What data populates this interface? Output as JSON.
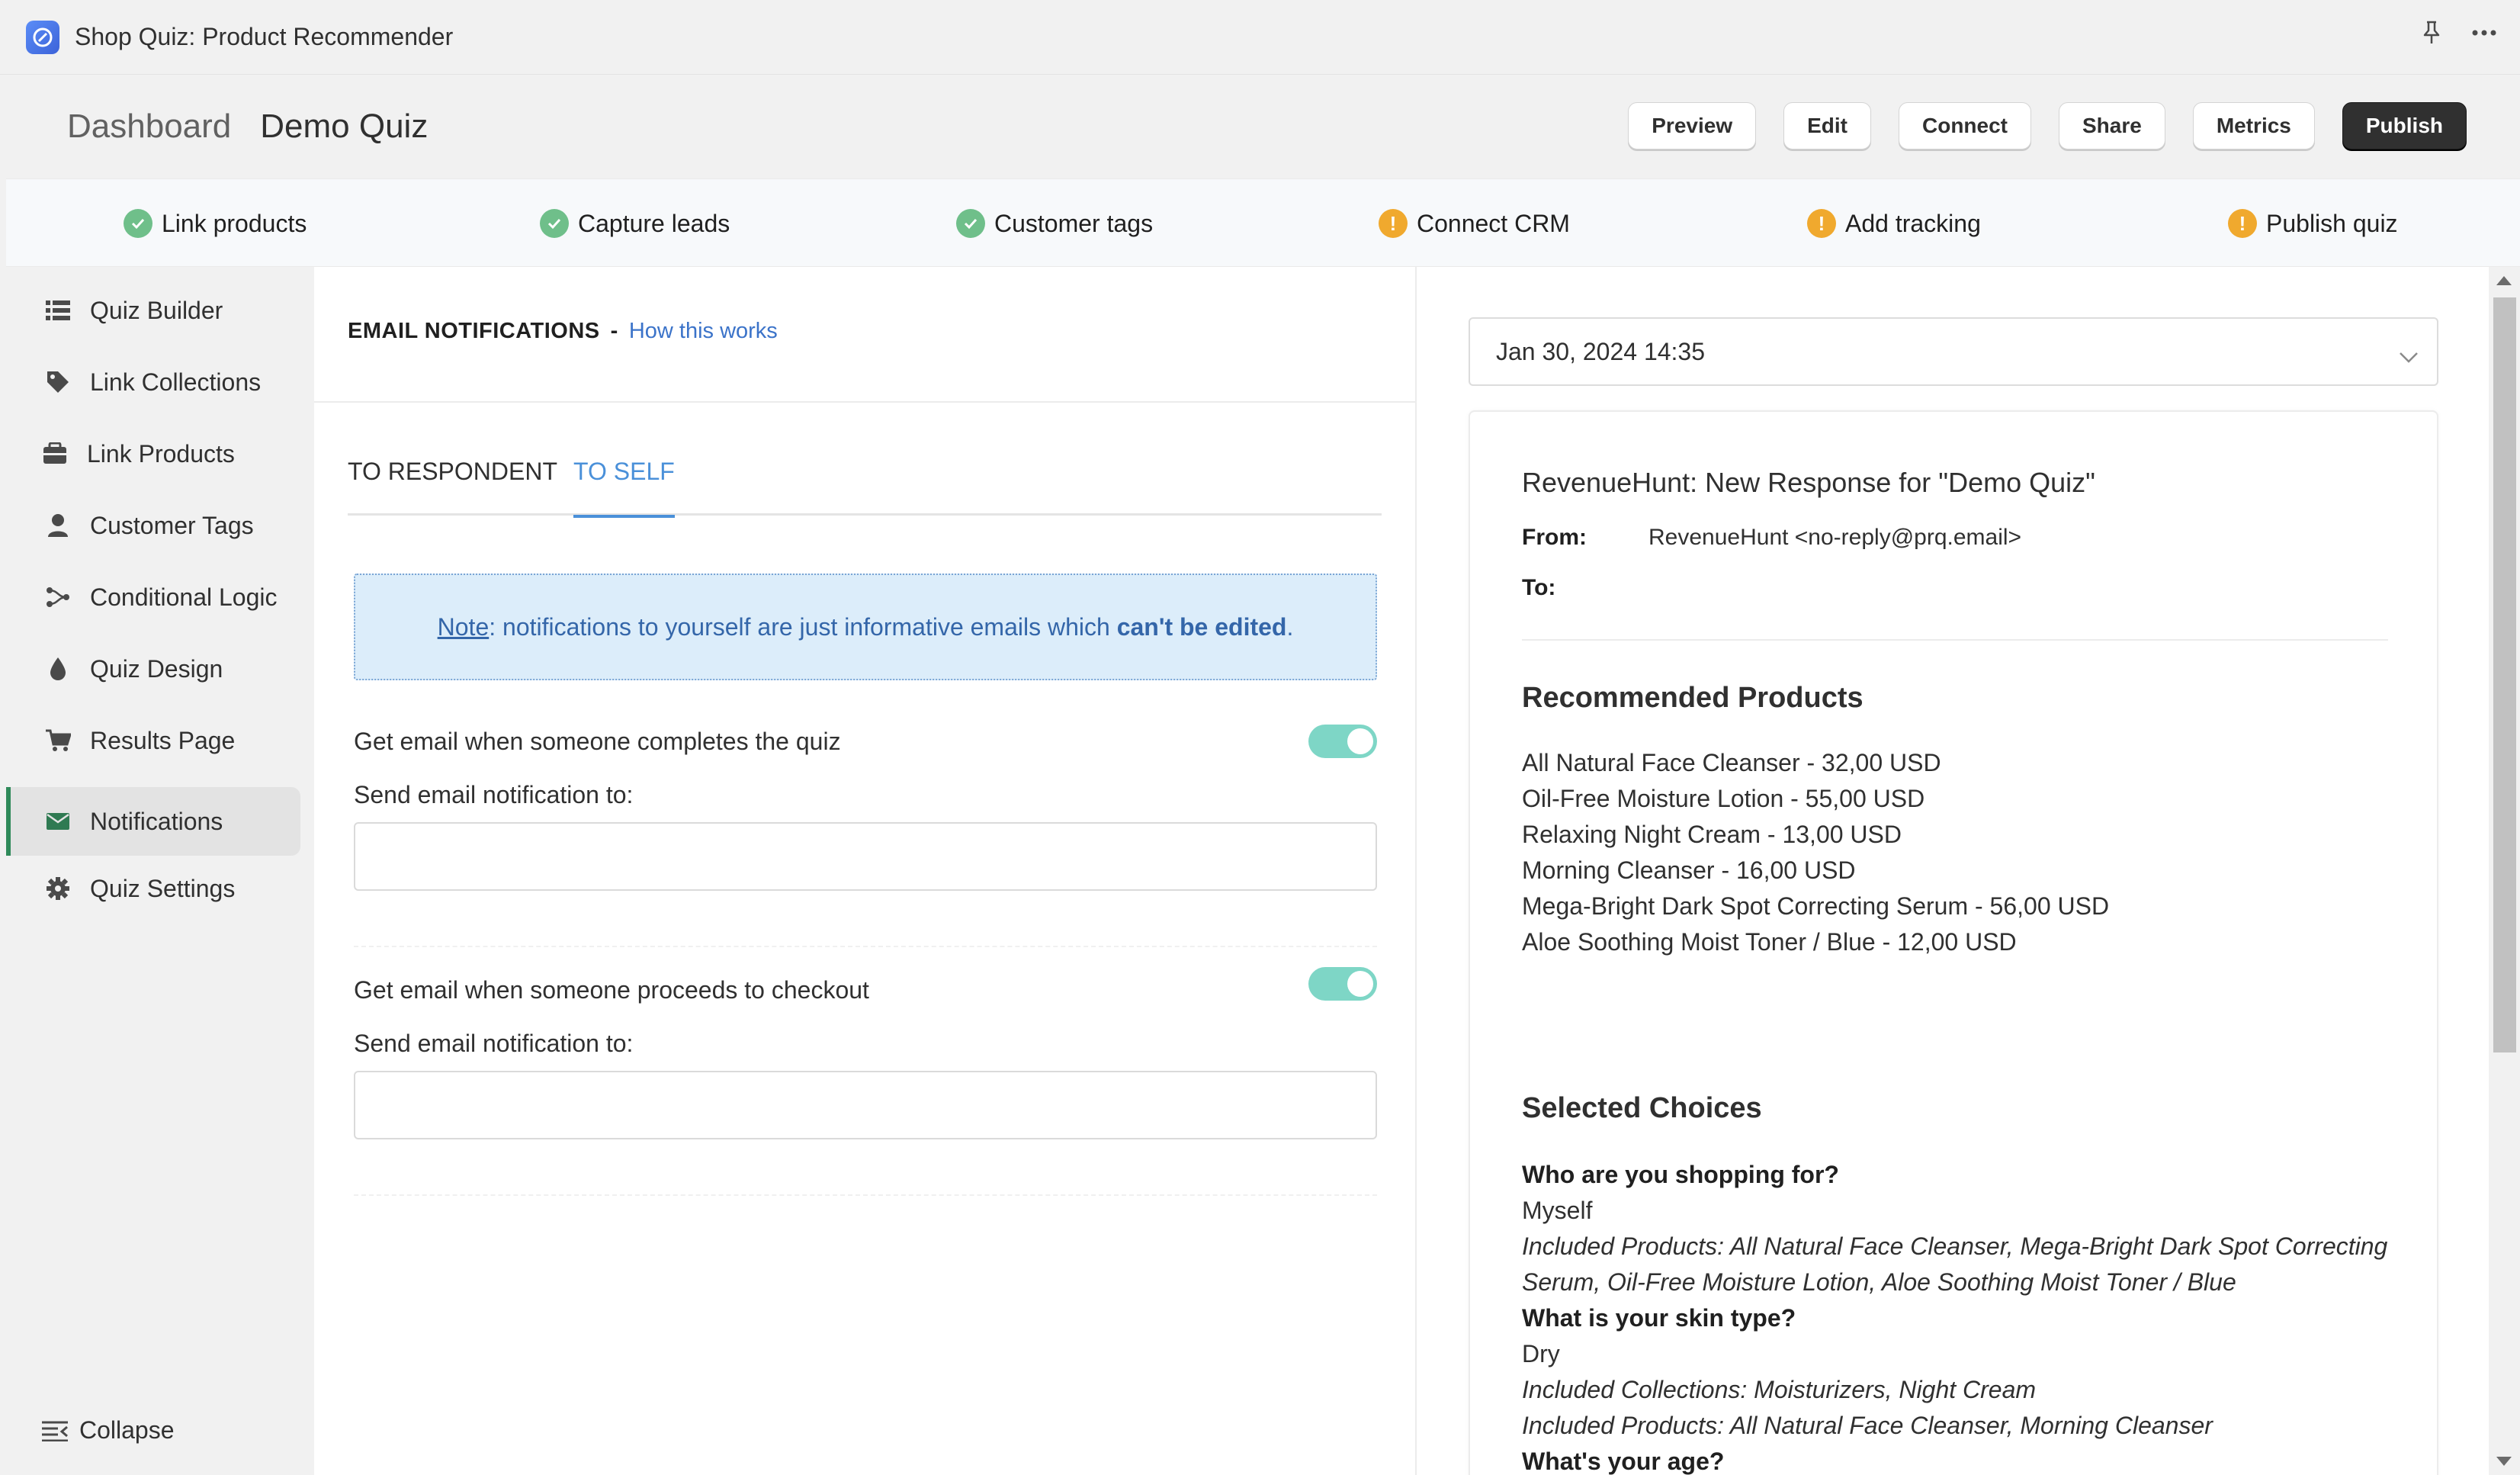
{
  "window": {
    "title": "Shop Quiz: Product Recommender",
    "icons": [
      "app-logo-icon",
      "pin-icon",
      "more-icon"
    ]
  },
  "header": {
    "breadcrumb": "Dashboard",
    "title": "Demo Quiz",
    "actions": {
      "preview": "Preview",
      "edit": "Edit",
      "connect": "Connect",
      "share": "Share",
      "metrics": "Metrics",
      "publish": "Publish"
    }
  },
  "progress_steps": [
    {
      "label": "Link products",
      "status": "done"
    },
    {
      "label": "Capture leads",
      "status": "done"
    },
    {
      "label": "Customer tags",
      "status": "done"
    },
    {
      "label": "Connect CRM",
      "status": "warning"
    },
    {
      "label": "Add tracking",
      "status": "warning"
    },
    {
      "label": "Publish quiz",
      "status": "warning"
    }
  ],
  "sidebar": {
    "items": [
      {
        "label": "Quiz Builder",
        "icon": "list-icon"
      },
      {
        "label": "Link Collections",
        "icon": "tag-icon"
      },
      {
        "label": "Link Products",
        "icon": "box-icon"
      },
      {
        "label": "Customer Tags",
        "icon": "person-icon"
      },
      {
        "label": "Conditional Logic",
        "icon": "branch-icon"
      },
      {
        "label": "Quiz Design",
        "icon": "drop-icon"
      },
      {
        "label": "Results Page",
        "icon": "cart-icon"
      },
      {
        "label": "Notifications",
        "icon": "envelope-icon",
        "active": true
      },
      {
        "label": "Quiz Settings",
        "icon": "gear-icon"
      }
    ],
    "collapse_label": "Collapse"
  },
  "editor": {
    "section_title": "EMAIL NOTIFICATIONS",
    "separator": "-",
    "how_link": "How this works",
    "tabs": [
      {
        "label": "TO RESPONDENT"
      },
      {
        "label": "TO SELF",
        "active": true
      }
    ],
    "note": {
      "prefix": "Note",
      "text": ": notifications to yourself are just informative emails which ",
      "bold": "can't be edited",
      "suffix": "."
    },
    "notification_complete": {
      "label": "Get email when someone completes the quiz",
      "enabled": true,
      "send_to_label": "Send email notification to:",
      "value": ""
    },
    "notification_checkout": {
      "label": "Get email when someone proceeds to checkout",
      "enabled": true,
      "send_to_label": "Send email notification to:",
      "value": ""
    }
  },
  "preview": {
    "selected_date": "Jan 30, 2024 14:35",
    "subject": "RevenueHunt: New Response for \"Demo Quiz\"",
    "from_label": "From:",
    "from_value": "RevenueHunt <no-reply@prq.email>",
    "to_label": "To:",
    "recommended_heading": "Recommended Products",
    "products": [
      "All Natural Face Cleanser - 32,00 USD",
      "Oil-Free Moisture Lotion - 55,00 USD",
      "Relaxing Night Cream - 13,00 USD",
      "Morning Cleanser - 16,00 USD",
      "Mega-Bright Dark Spot Correcting Serum - 56,00 USD",
      "Aloe Soothing Moist Toner / Blue - 12,00 USD"
    ],
    "choices_heading": "Selected Choices",
    "choices": {
      "q1": "Who are you shopping for?",
      "a1": "Myself",
      "p1a": "Included Products: All Natural Face Cleanser, Mega-Bright Dark Spot Correcting",
      "p1b": "Serum, Oil-Free Moisture Lotion, Aloe Soothing Moist Toner / Blue",
      "q2": "What is your skin type?",
      "a2": "Dry",
      "c2": "Included Collections: Moisturizers, Night Cream",
      "p2": "Included Products: All Natural Face Cleanser, Morning Cleanser",
      "q3": "What's your age?"
    }
  },
  "colors": {
    "accent_blue": "#4a90d9",
    "done_green": "#6fbf8a",
    "warning_orange": "#f0a92e",
    "toggle_on": "#7ed6c6",
    "publish_bg": "#303030"
  }
}
